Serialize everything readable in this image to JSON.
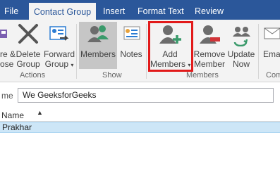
{
  "tabs": [
    {
      "label": "File"
    },
    {
      "label": "Contact Group",
      "active": true
    },
    {
      "label": "Insert"
    },
    {
      "label": "Format Text"
    },
    {
      "label": "Review"
    }
  ],
  "ribbon": {
    "actions": {
      "save_close": {
        "line1": "re &",
        "line2": "ose"
      },
      "delete_group": {
        "line1": "Delete",
        "line2": "Group"
      },
      "forward_group": {
        "line1": "Forward",
        "line2": "Group"
      },
      "group_label": "Actions"
    },
    "show": {
      "members": {
        "label": "Members"
      },
      "notes": {
        "label": "Notes"
      },
      "group_label": "Show"
    },
    "members": {
      "add_members": {
        "line1": "Add",
        "line2": "Members"
      },
      "remove_member": {
        "line1": "Remove",
        "line2": "Member"
      },
      "update_now": {
        "line1": "Update",
        "line2": "Now"
      },
      "group_label": "Members"
    },
    "communicate": {
      "email": {
        "label": "Ema"
      },
      "group_label": "Com"
    }
  },
  "form": {
    "name_label": "me",
    "name_value": "We GeeksforGeeks"
  },
  "grid": {
    "columns": [
      {
        "label": "Name",
        "sort": "ascending"
      }
    ],
    "rows": [
      {
        "name": "Prakhar"
      }
    ]
  },
  "colors": {
    "accent": "#2b579a",
    "highlight_box": "#e21a1a",
    "row_selected": "#cde6f7"
  }
}
